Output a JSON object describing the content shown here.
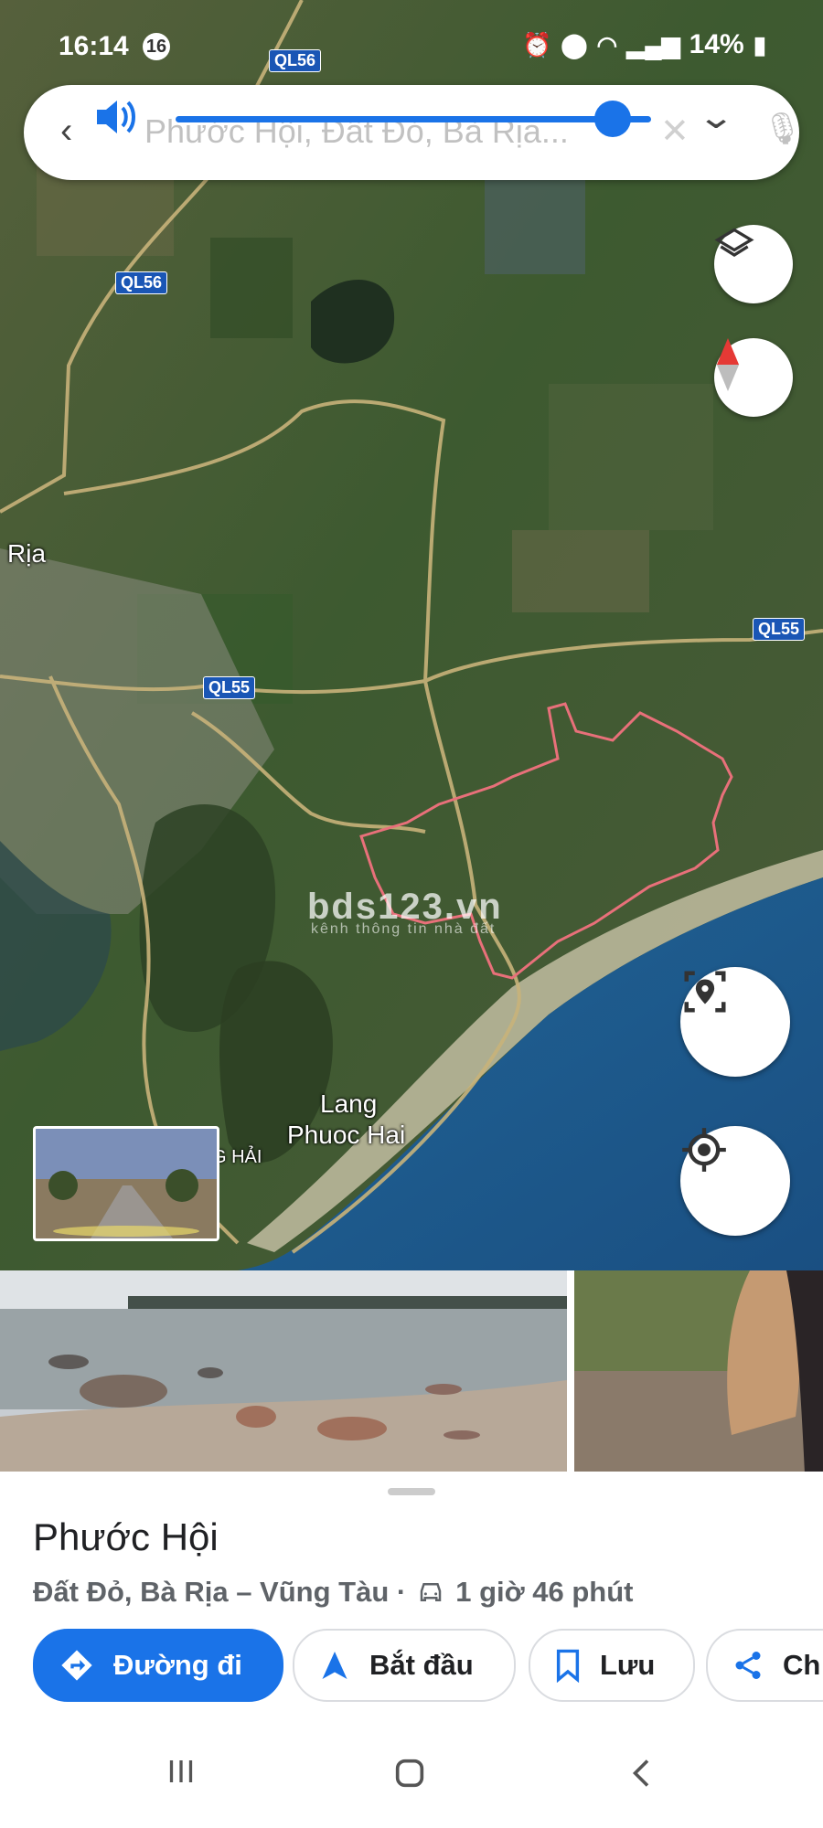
{
  "status_bar": {
    "time": "16:14",
    "notif_badge": "16",
    "battery": "14%",
    "icons": [
      "alarm-icon",
      "location-icon",
      "wifi-icon",
      "signal-icon",
      "signal-icon",
      "battery-icon"
    ]
  },
  "search": {
    "back_icon": "arrow-back-icon",
    "query": "Phước Hội, Đất Đỏ, Bà Rịa...",
    "clear_icon": "close-icon",
    "mic_icon": "mic-icon"
  },
  "volume": {
    "icon": "speaker-icon",
    "level": 0.92,
    "expand_icon": "chevron-down-icon"
  },
  "map": {
    "road_labels": [
      "QL56",
      "QL56",
      "QL55",
      "QL55"
    ],
    "place_labels": {
      "ria": "Rịa",
      "lang_line1": "Lang",
      "lang_line2": "Phuoc Hai",
      "hai": "G HẢI"
    },
    "watermark": "bds123.vn",
    "watermark_sub": "kênh thông tin nhà đất",
    "colors": {
      "boundary": "#e8707a",
      "road": "#c8b27a",
      "sea": "#1f5a8a",
      "land": "#3e5a32"
    },
    "buttons": [
      "layers-icon",
      "compass-icon",
      "street-view-pin-icon",
      "my-location-icon"
    ]
  },
  "streetview_thumb": {
    "caption": "street view"
  },
  "place": {
    "name": "Phước Hội",
    "address": "Đất Đỏ, Bà Rịa – Vũng Tàu ·",
    "drive_time": "1 giờ 46 phút",
    "car_icon": "car-icon"
  },
  "actions": [
    {
      "label": "Đường đi",
      "icon": "directions-icon"
    },
    {
      "label": "Bắt đầu",
      "icon": "navigation-arrow-icon"
    },
    {
      "label": "Lưu",
      "icon": "bookmark-icon"
    },
    {
      "label": "Ch",
      "icon": "share-icon"
    }
  ],
  "system_nav": [
    "recents-icon",
    "home-icon",
    "back-icon"
  ]
}
